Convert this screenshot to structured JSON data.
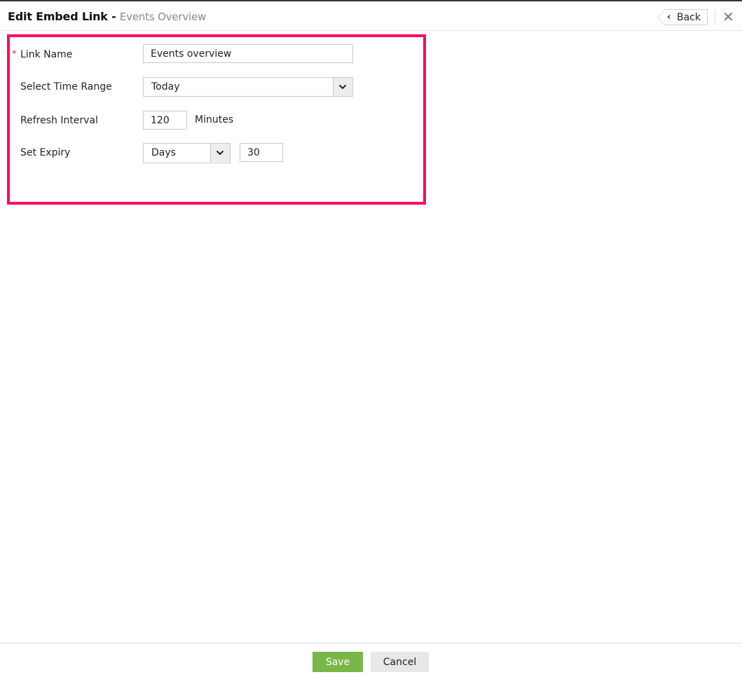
{
  "header": {
    "title": "Edit Embed Link",
    "separator": " - ",
    "subtitle": "Events Overview",
    "back_label": "Back",
    "back_icon": "‹",
    "close_icon": "✕"
  },
  "form": {
    "required_marker": "*",
    "link_name": {
      "label": "Link Name",
      "value": "Events overview"
    },
    "time_range": {
      "label": "Select Time Range",
      "value": "Today"
    },
    "refresh_interval": {
      "label": "Refresh Interval",
      "value": "120",
      "unit": "Minutes"
    },
    "expiry": {
      "label": "Set Expiry",
      "unit_value": "Days",
      "value": "30"
    }
  },
  "footer": {
    "save_label": "Save",
    "cancel_label": "Cancel"
  },
  "colors": {
    "highlight": "#ff0a5a",
    "save": "#7ab648",
    "cancel": "#e8e8e8"
  }
}
